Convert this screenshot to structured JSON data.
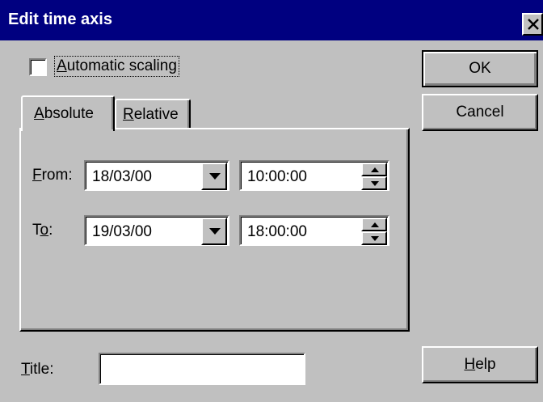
{
  "window": {
    "title": "Edit time axis"
  },
  "auto_scaling": {
    "mnemonic": "A",
    "rest": "utomatic scaling",
    "checked": false
  },
  "tabs": [
    {
      "mnemonic": "A",
      "rest": "bsolute",
      "active": true
    },
    {
      "mnemonic": "R",
      "rest": "elative",
      "active": false
    }
  ],
  "from": {
    "mnemonic": "F",
    "rest": "rom:",
    "date": "18/03/00",
    "time": "10:00:00"
  },
  "to": {
    "pre": "T",
    "mnemonic": "o",
    "rest": ":",
    "date": "19/03/00",
    "time": "18:00:00"
  },
  "title_field": {
    "mnemonic": "T",
    "rest": "itle:",
    "value": ""
  },
  "buttons": {
    "ok": "OK",
    "cancel": "Cancel",
    "help_mnemonic": "H",
    "help_rest": "elp"
  }
}
